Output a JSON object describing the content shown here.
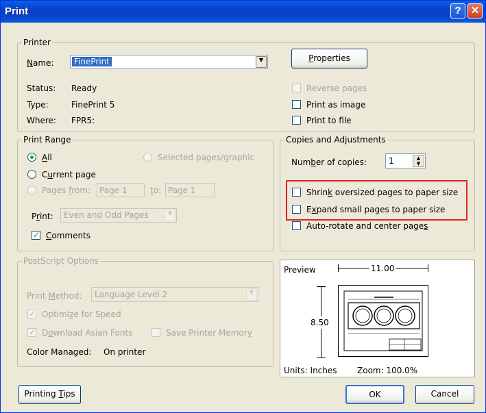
{
  "window": {
    "title": "Print",
    "help_glyph": "?",
    "close_glyph": "✕"
  },
  "printer": {
    "group_title": "Printer",
    "name_label": "Name:",
    "name_value": "FinePrint",
    "properties_label": "Properties",
    "status_label": "Status:",
    "status_value": "Ready",
    "type_label": "Type:",
    "type_value": "FinePrint 5",
    "where_label": "Where:",
    "where_value": "FPR5:",
    "reverse_pages": {
      "label": "Reverse pages",
      "checked": false,
      "enabled": false
    },
    "print_as_image": {
      "label": "Print as image",
      "checked": false,
      "enabled": true
    },
    "print_to_file": {
      "label": "Print to file",
      "checked": false,
      "enabled": true
    }
  },
  "print_range": {
    "group_title": "Print Range",
    "all_label": "All",
    "selected_label": "Selected pages/graphic",
    "current_label": "Current page",
    "pages_from_label": "Pages from:",
    "from_value": "Page 1",
    "to_label": "to:",
    "to_value": "Page 1",
    "print_label": "Print:",
    "print_value": "Even and Odd Pages",
    "comments_label": "Comments",
    "comments_checked": true
  },
  "copies": {
    "group_title": "Copies and Adjustments",
    "number_label": "Number of copies:",
    "number_value": "1",
    "shrink_label": "Shrink oversized pages to paper size",
    "expand_label": "Expand small pages to paper size",
    "autorotate_label": "Auto-rotate and center pages"
  },
  "postscript": {
    "group_title": "PostScript Options",
    "method_label": "Print Method:",
    "method_value": "Language Level 2",
    "optimize_label": "Optimize for Speed",
    "download_label": "Download Asian Fonts",
    "save_memory_label": "Save Printer Memory",
    "color_label": "Color Managed:",
    "color_value": "On printer"
  },
  "preview": {
    "label": "Preview",
    "width": "11.00",
    "height": "8.50",
    "units": "Units: Inches",
    "zoom": "Zoom: 100.0%"
  },
  "buttons": {
    "tips": "Printing Tips",
    "ok": "OK",
    "cancel": "Cancel"
  },
  "colors": {
    "title_bar": "#0842c9",
    "highlight": "#e22320",
    "check": "#21a121"
  }
}
